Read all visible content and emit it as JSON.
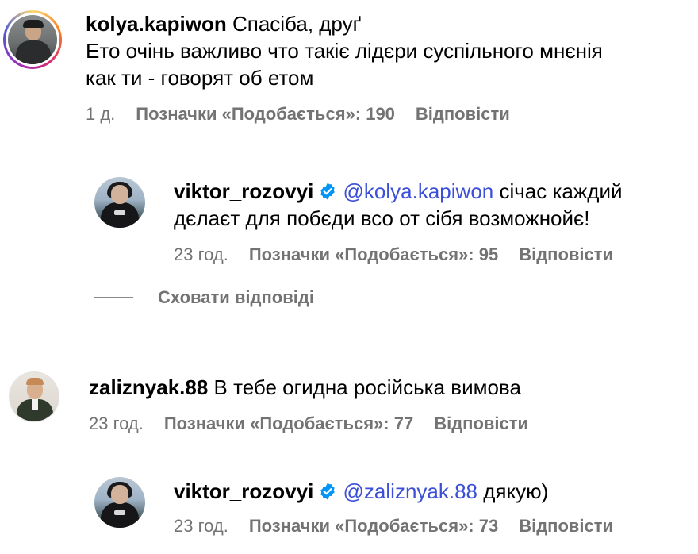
{
  "comments": [
    {
      "username": "kolya.kapiwon",
      "text_line1": "Спасіба, друґ",
      "text_line2": "Ето очінь важливо что такіє лідєри суспільного мнєнія",
      "text_line3": "как ти - говорят об етом",
      "time": "1 д.",
      "likes": "Позначки «Подобається»: 190",
      "reply": "Відповісти"
    },
    {
      "username": "viktor_rozovyi",
      "verified_icon": "verified-badge-icon",
      "mention": "@kolya.kapiwon",
      "text_line1": "січас каждий",
      "text_line2": "дєлаєт для побєди всо от сібя возможнойє!",
      "time": "23 год.",
      "likes": "Позначки «Подобається»: 95",
      "reply": "Відповісти"
    },
    {
      "username": "zaliznyak.88",
      "text_line1": "В тебе огидна російська вимова",
      "time": "23 год.",
      "likes": "Позначки «Подобається»: 77",
      "reply": "Відповісти"
    },
    {
      "username": "viktor_rozovyi",
      "verified_icon": "verified-badge-icon",
      "mention": "@zaliznyak.88",
      "text_line1": "дякую)",
      "time": "23 год.",
      "likes": "Позначки «Подобається»: 73",
      "reply": "Відповісти"
    }
  ],
  "hide_replies_label": "Сховати відповіді",
  "colors": {
    "mention": "#3b4fd8",
    "verified": "#0095f6",
    "meta": "#737373"
  }
}
